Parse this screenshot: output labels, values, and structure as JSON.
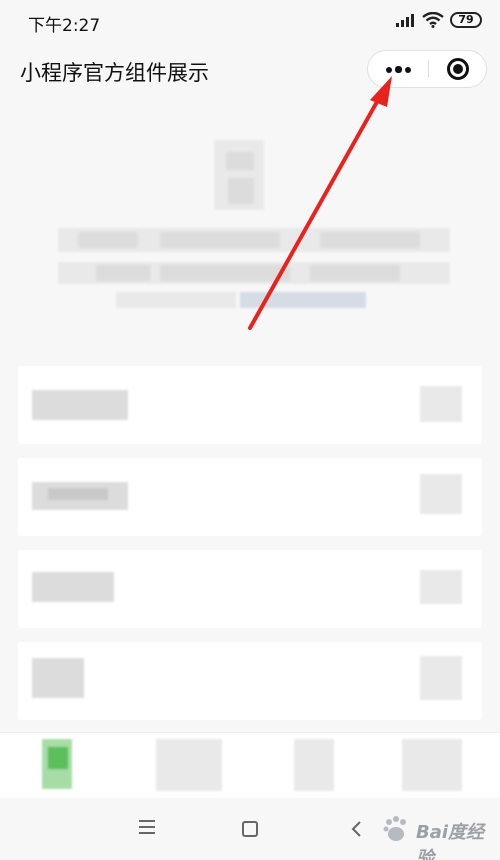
{
  "status_bar": {
    "time": "下午2:27",
    "battery_level": "79",
    "icons": [
      "signal-icon",
      "wifi-icon",
      "battery-icon"
    ]
  },
  "nav_bar": {
    "title": "小程序官方组件展示",
    "capsule_icons": [
      "more-dots-icon",
      "close-circle-icon"
    ]
  },
  "system_nav": {
    "icons": [
      "menu-icon",
      "home-icon",
      "back-icon"
    ]
  },
  "watermark": {
    "text": "Bai度经验"
  },
  "annotation": {
    "color": "#e8231f"
  }
}
